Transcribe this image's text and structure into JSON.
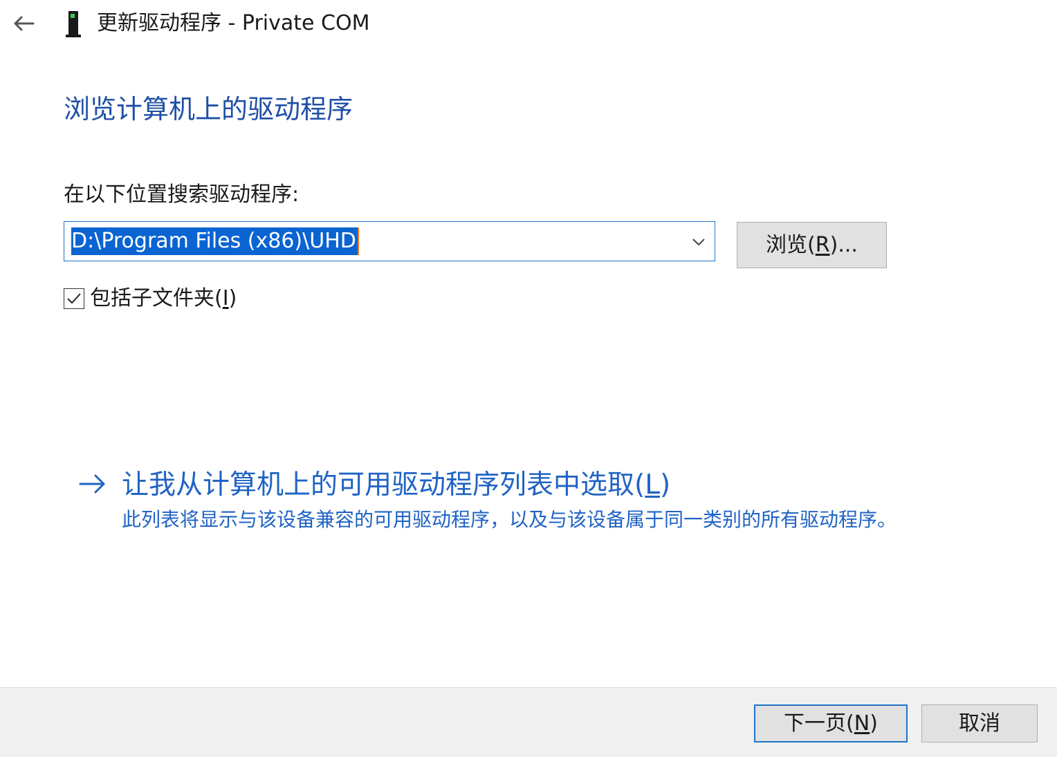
{
  "header": {
    "back_icon": "arrow-left-icon",
    "device_icon": "device-icon",
    "title": "更新驱动程序 - Private COM"
  },
  "main": {
    "heading": "浏览计算机上的驱动程序",
    "search_label": "在以下位置搜索驱动程序:",
    "path_value": "D:\\Program Files (x86)\\UHD",
    "browse_button": {
      "prefix": "浏览(",
      "accelerator": "R",
      "suffix": ")..."
    },
    "include_subfolders": {
      "checked": true,
      "prefix": "包括子文件夹(",
      "accelerator": "I",
      "suffix": ")"
    },
    "pick_option": {
      "icon": "arrow-right-icon",
      "title_prefix": "让我从计算机上的可用驱动程序列表中选取(",
      "title_accelerator": "L",
      "title_suffix": ")",
      "description": "此列表将显示与该设备兼容的可用驱动程序，以及与该设备属于同一类别的所有驱动程序。"
    }
  },
  "footer": {
    "next_button": {
      "prefix": "下一页(",
      "accelerator": "N",
      "suffix": ")"
    },
    "cancel_button": "取消"
  },
  "colors": {
    "heading_blue": "#1f4fa6",
    "link_blue": "#1f63c4",
    "selection_blue": "#0a64d2",
    "focus_border": "#1e74c8",
    "footer_bg": "#f0f0f0",
    "button_bg": "#e1e1e1"
  }
}
